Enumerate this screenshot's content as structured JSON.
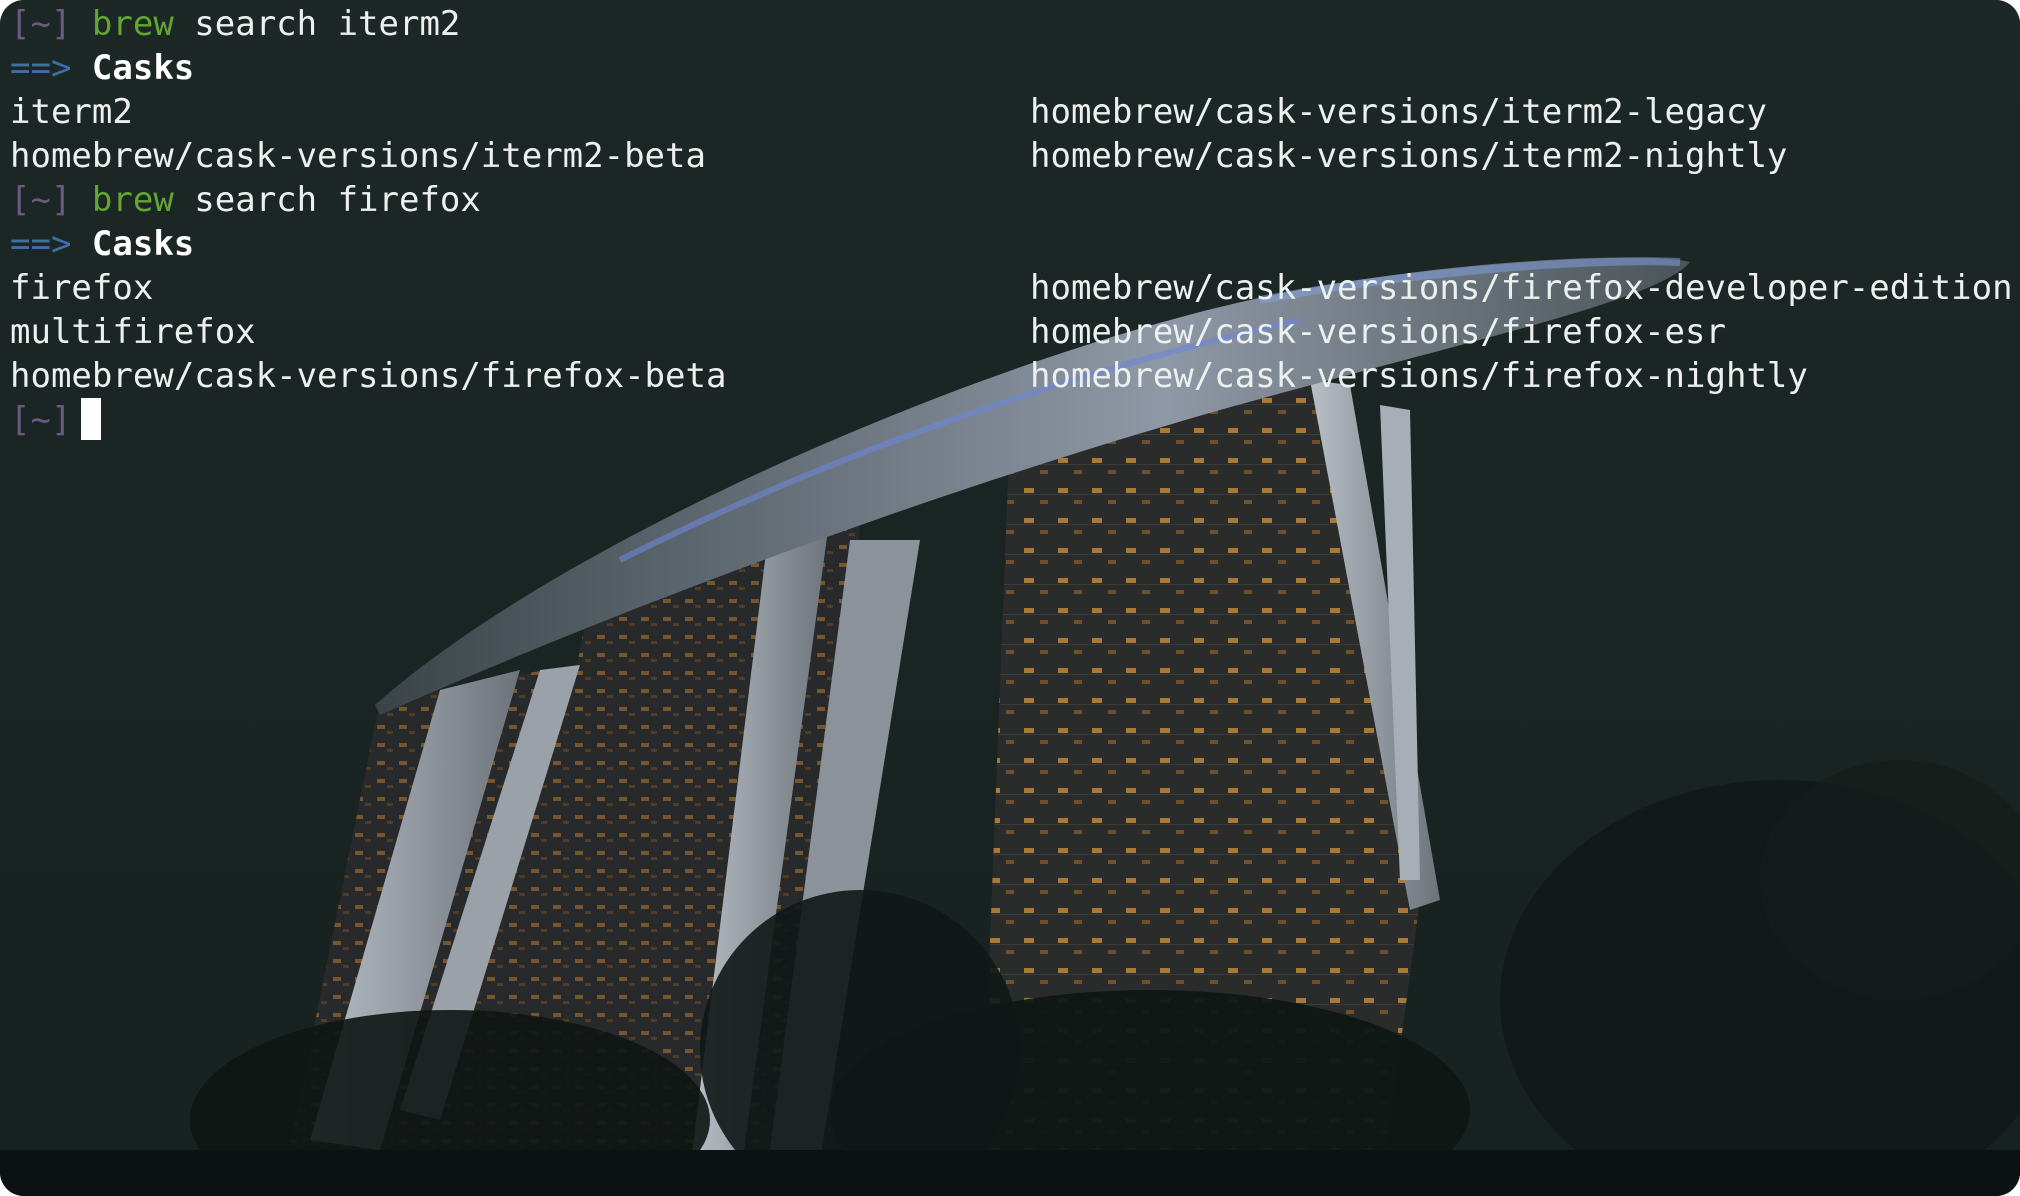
{
  "terminal": {
    "prompt": "[~]",
    "arrow": "==>",
    "sessions": [
      {
        "command": "brew",
        "args": "search iterm2",
        "heading": "Casks",
        "rows": [
          [
            "iterm2",
            "homebrew/cask-versions/iterm2-legacy"
          ],
          [
            "homebrew/cask-versions/iterm2-beta",
            "homebrew/cask-versions/iterm2-nightly"
          ]
        ]
      },
      {
        "command": "brew",
        "args": "search firefox",
        "heading": "Casks",
        "rows": [
          [
            "firefox",
            "homebrew/cask-versions/firefox-developer-edition"
          ],
          [
            "multifirefox",
            "homebrew/cask-versions/firefox-esr"
          ],
          [
            "homebrew/cask-versions/firefox-beta",
            "homebrew/cask-versions/firefox-nightly"
          ]
        ]
      }
    ]
  },
  "colors": {
    "background": "#1c2624",
    "text": "#ecf0ee",
    "prompt": "#6a5a82",
    "command": "#62a632",
    "arrow": "#3f6fa8"
  }
}
